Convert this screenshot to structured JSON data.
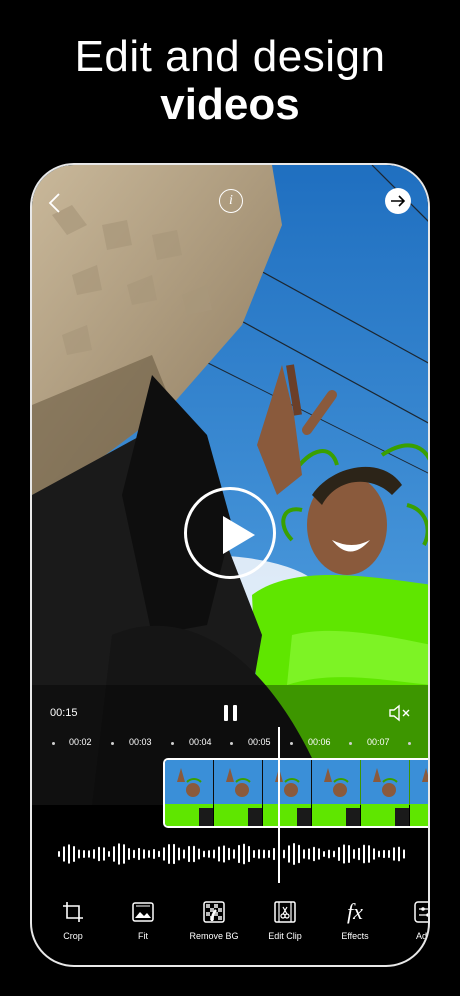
{
  "headline": {
    "line1": "Edit and design",
    "line2": "videos"
  },
  "top_bar": {
    "info_glyph": "i"
  },
  "player": {
    "current_time": "00:15"
  },
  "timeline": {
    "marks": [
      "00:02",
      "00:03",
      "00:04",
      "00:05",
      "00:06",
      "00:07"
    ]
  },
  "toolbar": {
    "items": [
      {
        "label": "Crop",
        "icon": "crop-icon"
      },
      {
        "label": "Fit",
        "icon": "fit-icon"
      },
      {
        "label": "Remove BG",
        "icon": "remove-bg-icon"
      },
      {
        "label": "Edit Clip",
        "icon": "edit-clip-icon"
      },
      {
        "label": "Effects",
        "icon": "effects-icon",
        "glyph": "fx"
      },
      {
        "label": "Adju",
        "icon": "adjust-icon"
      }
    ]
  },
  "colors": {
    "sky": "#2f86d4",
    "shirt": "#5fe600",
    "background": "#000000"
  }
}
